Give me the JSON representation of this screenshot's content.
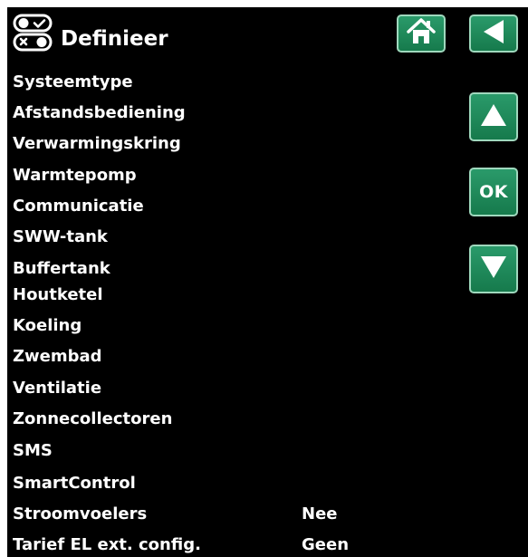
{
  "header": {
    "title": "Definieer",
    "icon": "settings-toggle-icon"
  },
  "nav": {
    "home_icon": "home-icon",
    "back_icon": "back-arrow-icon",
    "up_icon": "arrow-up-icon",
    "down_icon": "arrow-down-icon",
    "ok_label": "OK"
  },
  "menu": {
    "items": [
      {
        "label": "Systeemtype"
      },
      {
        "label": "Afstandsbediening"
      },
      {
        "label": "Verwarmingskring"
      },
      {
        "label": "Warmtepomp"
      },
      {
        "label": "Communicatie"
      },
      {
        "label": "SWW-tank"
      },
      {
        "label": "Buffertank"
      },
      {
        "label": "Houtketel"
      },
      {
        "label": "Koeling"
      },
      {
        "label": "Zwembad"
      },
      {
        "label": "Ventilatie"
      },
      {
        "label": "Zonnecollectoren"
      },
      {
        "label": "SMS"
      },
      {
        "label": "SmartControl"
      },
      {
        "label": "Stroomvoelers",
        "value": "Nee"
      },
      {
        "label": "Tarief EL ext. config.",
        "value": "Geen"
      }
    ]
  },
  "colors": {
    "background": "#000000",
    "text": "#ffffff",
    "button_green": "#1e8a5a",
    "button_border": "#9fd8bd"
  }
}
